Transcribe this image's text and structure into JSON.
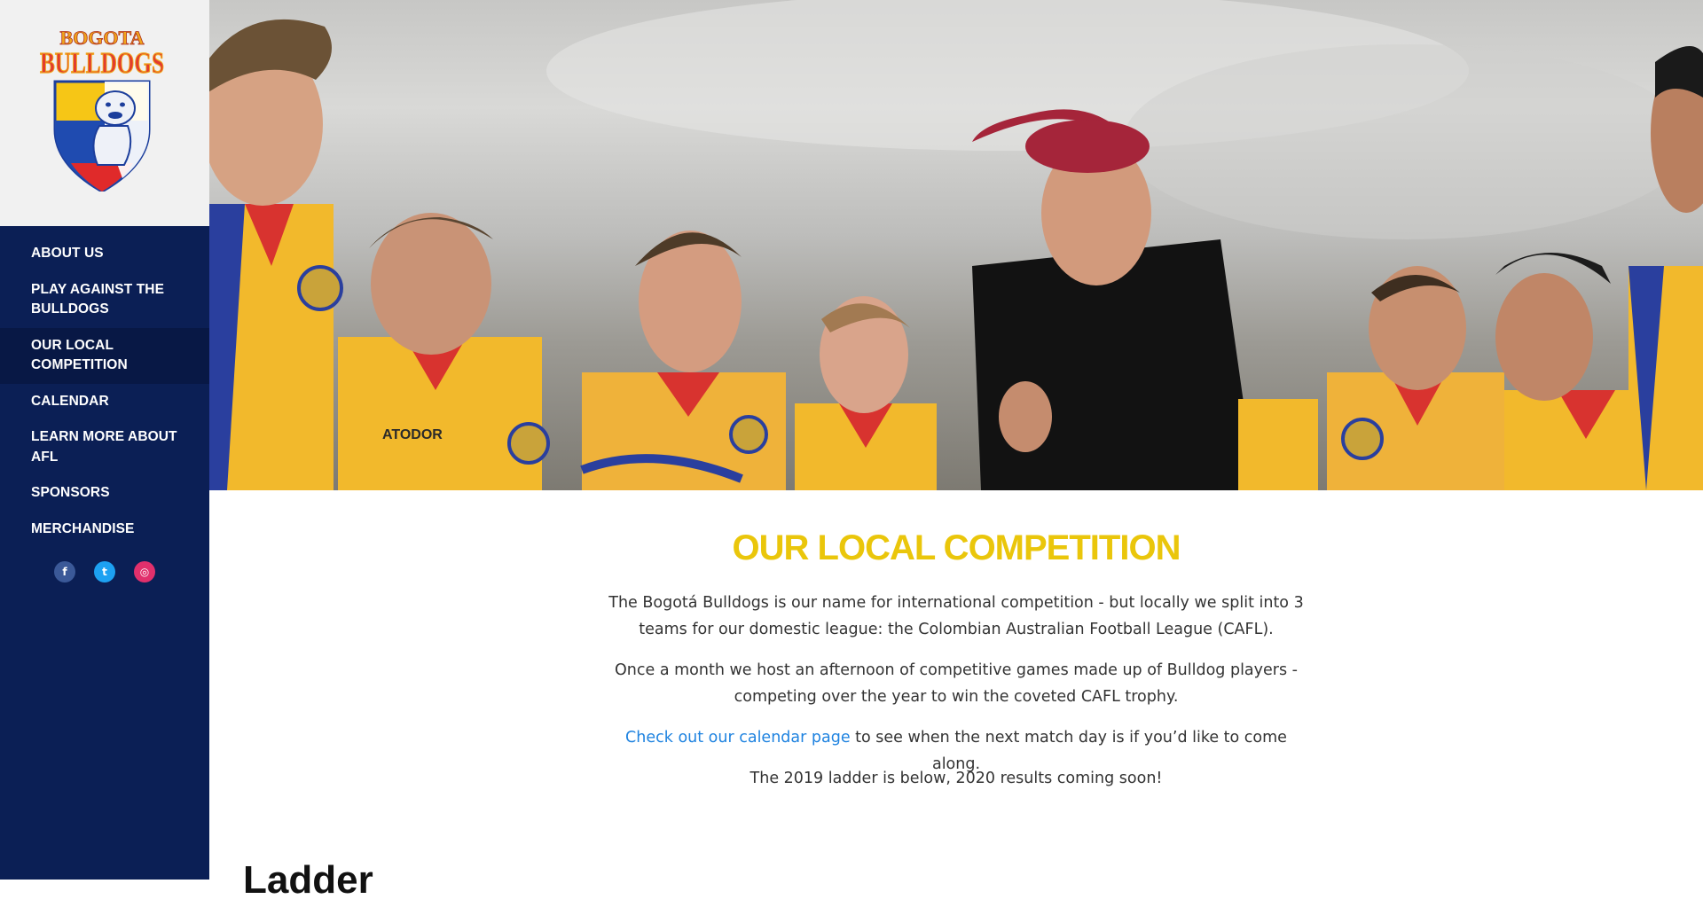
{
  "sidebar": {
    "logo": {
      "top_text": "BOGOTA",
      "main_text": "BULLDOGS"
    },
    "nav": [
      {
        "label": "ABOUT US"
      },
      {
        "label": "PLAY AGAINST THE BULLDOGS"
      },
      {
        "label": "OUR LOCAL COMPETITION",
        "active": true
      },
      {
        "label": "CALENDAR"
      },
      {
        "label": "LEARN MORE ABOUT AFL"
      },
      {
        "label": "SPONSORS"
      },
      {
        "label": "MERCHANDISE"
      }
    ],
    "social": {
      "facebook": "f",
      "twitter": "t",
      "instagram": "◎",
      "icons": [
        "facebook-icon",
        "twitter-icon",
        "instagram-icon"
      ]
    }
  },
  "hero": {
    "image_alt": "",
    "jersey_text": "ATODOR"
  },
  "main": {
    "title": "OUR LOCAL COMPETITION",
    "paragraph1": "The Bogotá Bulldogs is our name for international competition - but locally we split into 3 teams for our domestic league: the Colombian Australian Football League (CAFL).",
    "paragraph2": "Once a month we host an afternoon of competitive games made up of Bulldog players - competing over the year to win the coveted CAFL trophy.",
    "paragraph3_link": "Check out our calendar page",
    "paragraph3_rest": " to see when the next match day is if you’d like to come along.",
    "paragraph4": "The 2019 ladder is below, 2020 results coming soon!",
    "ladder_heading": "Ladder"
  },
  "colors": {
    "sidebar_bg": "#0b1f55",
    "active_nav_bg": "#081845",
    "heading_yellow": "#eac60b",
    "link_blue": "#1f83e0",
    "jersey_yellow": "#f2b92c",
    "jersey_blue": "#2a3f9e",
    "jersey_red": "#d8332f"
  }
}
